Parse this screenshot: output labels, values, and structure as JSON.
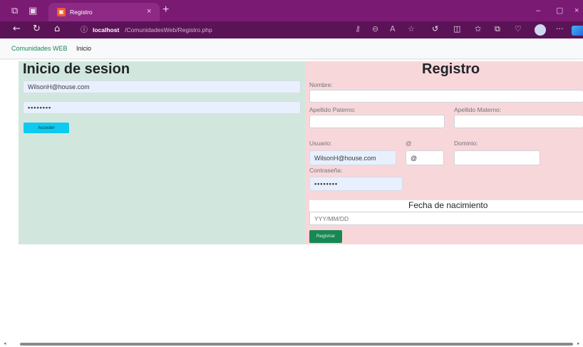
{
  "browser": {
    "tab_title": "Registro",
    "tab_close": "×",
    "new_tab": "+",
    "favicon_glyph": "▣",
    "url_host": "localhost",
    "url_path": "/ComunidadesWeb/Registro.php",
    "window_controls": {
      "minimize": "–",
      "maximize": "▢",
      "close": "×"
    },
    "icons": [
      "workspaces-icon",
      "tab-actions-icon",
      "back-icon",
      "refresh-icon",
      "home-icon",
      "site-info-icon",
      "key-icon",
      "zoom-icon",
      "read-aloud-icon",
      "favorite-icon",
      "refresh-extension-icon",
      "split-screen-icon",
      "favorites-icon",
      "collections-icon",
      "browser-essentials-icon",
      "profile-icon",
      "more-icon",
      "copilot-icon"
    ]
  },
  "navbar": {
    "brand": "Comunidades WEB",
    "links": [
      "Inicio"
    ]
  },
  "login": {
    "title": "Inicio de sesion",
    "email_value": "WilsonH@house.com",
    "password_value": "••••••••",
    "submit_label": "Acceder",
    "colors": {
      "panel": "#d1e7dd",
      "button": "#0dcaf0"
    }
  },
  "register": {
    "title": "Registro",
    "labels": {
      "nombre": "Nombre:",
      "apellido_paterno": "Apellido Paterno:",
      "apellido_materno": "Apellido Materno:",
      "usuario": "Usuario:",
      "at": "@",
      "dominio": "Dominio:",
      "contrasena": "Contraseña:"
    },
    "values": {
      "usuario": "WilsonH@house.com",
      "at": "@",
      "contrasena": "••••••••"
    },
    "fecha_title": "Fecha de nacimiento",
    "fecha_placeholder": "YYY/MM/DD",
    "submit_label": "Registrar",
    "colors": {
      "panel": "#f8d7da",
      "button": "#198754"
    }
  }
}
